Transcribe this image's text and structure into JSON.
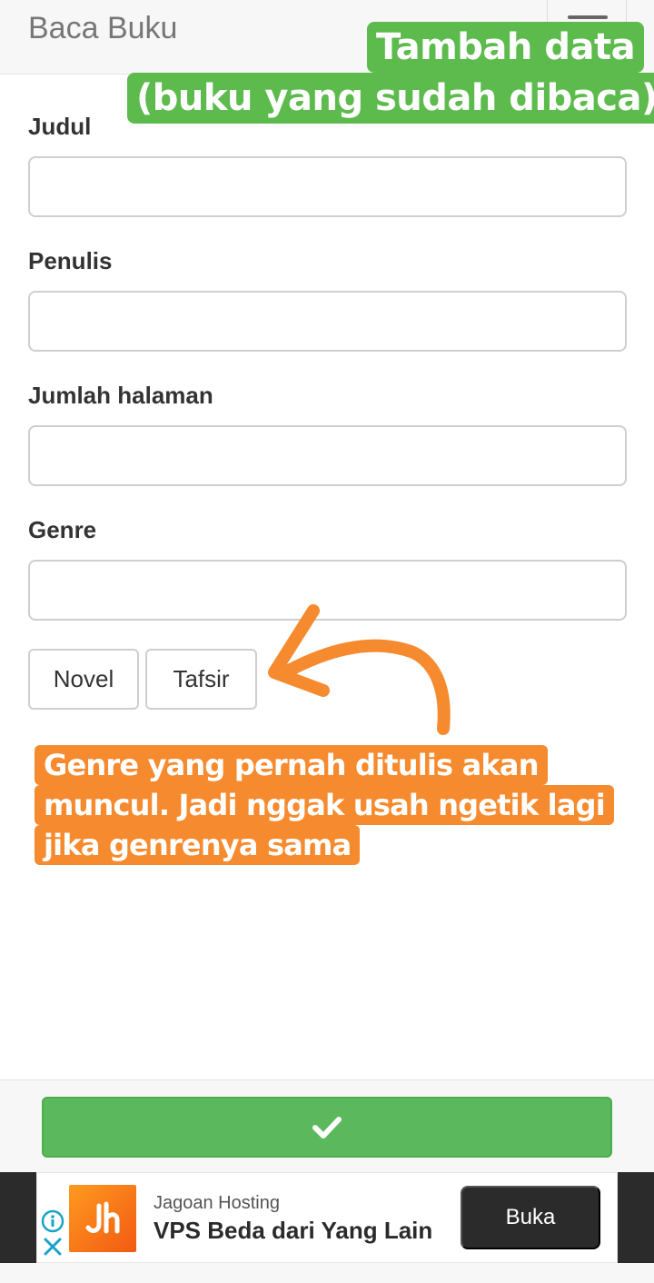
{
  "header": {
    "brand": "Baca Buku",
    "menu_icon": "hamburger-icon"
  },
  "form": {
    "fields": [
      {
        "label": "Judul",
        "value": ""
      },
      {
        "label": "Penulis",
        "value": ""
      },
      {
        "label": "Jumlah halaman",
        "value": ""
      },
      {
        "label": "Genre",
        "value": ""
      }
    ],
    "genre_options": [
      "Novel",
      "Tafsir"
    ]
  },
  "annotations": {
    "green_lines": [
      "Tambah data",
      "(buku yang sudah dibaca)"
    ],
    "orange_lines": [
      "Genre yang pernah ditulis akan",
      "muncul. Jadi nggak usah ngetik lagi",
      "jika genrenya sama"
    ],
    "green_color": "#5dbb4d",
    "orange_color": "#f68a2e"
  },
  "action": {
    "save_icon": "check-icon",
    "button_color": "#5cb85c"
  },
  "ad": {
    "advertiser": "Jagoan Hosting",
    "headline": "VPS Beda dari Yang Lain",
    "cta": "Buka",
    "info_icon": "info-icon",
    "close_icon": "close-icon"
  }
}
